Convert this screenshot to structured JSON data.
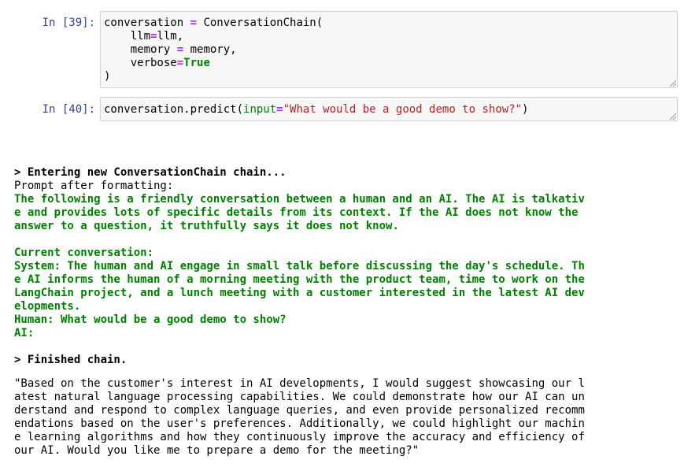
{
  "cells": [
    {
      "prompt": "In [39]:",
      "code_lines": [
        {
          "parts": [
            {
              "t": "conversation ",
              "c": ""
            },
            {
              "t": "=",
              "c": "op"
            },
            {
              "t": " ConversationChain(",
              "c": ""
            }
          ]
        },
        {
          "parts": [
            {
              "t": "    llm",
              "c": ""
            },
            {
              "t": "=",
              "c": "op"
            },
            {
              "t": "llm,",
              "c": ""
            }
          ]
        },
        {
          "parts": [
            {
              "t": "    memory ",
              "c": ""
            },
            {
              "t": "=",
              "c": "op"
            },
            {
              "t": " memory,",
              "c": ""
            }
          ]
        },
        {
          "parts": [
            {
              "t": "    verbose",
              "c": ""
            },
            {
              "t": "=",
              "c": "op"
            },
            {
              "t": "True",
              "c": "kw"
            }
          ]
        },
        {
          "parts": [
            {
              "t": ")",
              "c": ""
            }
          ]
        }
      ]
    },
    {
      "prompt": "In [40]:",
      "code_lines": [
        {
          "parts": [
            {
              "t": "conversation.predict(",
              "c": ""
            },
            {
              "t": "input",
              "c": "param"
            },
            {
              "t": "=",
              "c": "op"
            },
            {
              "t": "\"What would be a good demo to show?\"",
              "c": "str"
            },
            {
              "t": ")",
              "c": ""
            }
          ]
        }
      ]
    }
  ],
  "output": {
    "entering": "> Entering new ConversationChain chain...",
    "prompt_after": "Prompt after formatting:",
    "green_lines": [
      "The following is a friendly conversation between a human and an AI. The AI is talkativ",
      "e and provides lots of specific details from its context. If the AI does not know the",
      "answer to a question, it truthfully says it does not know.",
      "",
      "Current conversation:",
      "System: The human and AI engage in small talk before discussing the day's schedule. Th",
      "e AI informs the human of a morning meeting with the product team, time to work on the",
      "LangChain project, and a lunch meeting with a customer interested in the latest AI dev",
      "elopments.",
      "Human: What would be a good demo to show?",
      "AI:"
    ],
    "finished": "> Finished chain.",
    "result_lines": [
      "\"Based on the customer's interest in AI developments, I would suggest showcasing our l",
      "atest natural language processing capabilities. We could demonstrate how our AI can un",
      "derstand and respond to complex language queries, and even provide personalized recomm",
      "endations based on the user's preferences. Additionally, we could highlight our machin",
      "e learning algorithms and how they continuously improve the accuracy and efficiency of",
      "our AI. Would you like me to prepare a demo for the meeting?\""
    ]
  }
}
